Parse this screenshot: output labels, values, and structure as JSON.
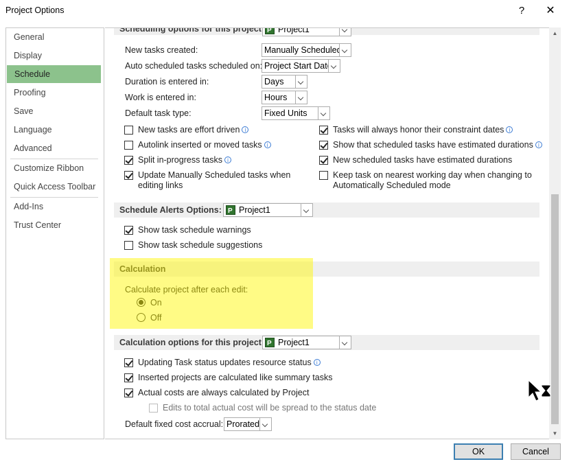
{
  "window": {
    "title": "Project Options",
    "help": "?",
    "close": "✕"
  },
  "sidebar": {
    "items": [
      "General",
      "Display",
      "Schedule",
      "Proofing",
      "Save",
      "Language",
      "Advanced",
      "Customize Ribbon",
      "Quick Access Toolbar",
      "Add-Ins",
      "Trust Center"
    ],
    "active": "Schedule"
  },
  "scheduling": {
    "header": "Scheduling options for this project:",
    "project": "Project1",
    "new_tasks_label": "New tasks created:",
    "new_tasks_value": "Manually Scheduled",
    "auto_sched_label": "Auto scheduled tasks scheduled on:",
    "auto_sched_value": "Project Start Date",
    "duration_label": "Duration is entered in:",
    "duration_value": "Days",
    "work_label": "Work is entered in:",
    "work_value": "Hours",
    "task_type_label": "Default task type:",
    "task_type_value": "Fixed Units",
    "cb_effort": "New tasks are effort driven",
    "cb_autolink": "Autolink inserted or moved tasks",
    "cb_split": "Split in-progress tasks",
    "cb_update_1": "Update Manually Scheduled tasks when",
    "cb_update_2": "editing links",
    "cb_honor": "Tasks will always honor their constraint dates",
    "cb_show_est": "Show that scheduled tasks have estimated durations",
    "cb_new_est": "New scheduled tasks have estimated durations",
    "cb_keep_1": "Keep task on nearest working day when changing to",
    "cb_keep_2": "Automatically Scheduled mode"
  },
  "alerts": {
    "header": "Schedule Alerts Options:",
    "project": "Project1",
    "cb_warnings": "Show task schedule warnings",
    "cb_suggestions": "Show task schedule suggestions"
  },
  "calculation": {
    "header": "Calculation",
    "question": "Calculate project after each edit:",
    "on": "On",
    "off": "Off"
  },
  "calc_options": {
    "header": "Calculation options for this project:",
    "project": "Project1",
    "cb_status": "Updating Task status updates resource status",
    "cb_inserted": "Inserted projects are calculated like summary tasks",
    "cb_actual": "Actual costs are always calculated by Project",
    "cb_edits": "Edits to total actual cost will be spread to the status date",
    "fixed_cost_label": "Default fixed cost accrual:",
    "fixed_cost_value": "Prorated"
  },
  "buttons": {
    "ok": "OK",
    "cancel": "Cancel"
  },
  "icons": {
    "info": "info-icon",
    "project": "project-file-icon"
  }
}
